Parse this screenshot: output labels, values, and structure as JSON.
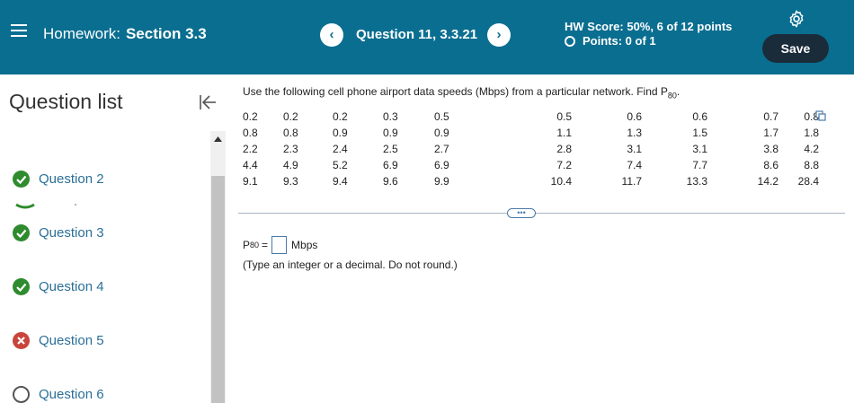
{
  "header": {
    "homework_label": "Homework:",
    "section": "Section 3.3",
    "question_title": "Question 11, 3.3.21",
    "prev_glyph": "‹",
    "next_glyph": "›",
    "hw_score": "HW Score: 50%, 6 of 12 points",
    "points": "Points: 0 of 1",
    "save_label": "Save"
  },
  "sidebar": {
    "title": "Question list",
    "items": [
      {
        "label": "Question 2",
        "status": "correct"
      },
      {
        "label": "Question 3",
        "status": "correct"
      },
      {
        "label": "Question 4",
        "status": "correct"
      },
      {
        "label": "Question 5",
        "status": "incorrect"
      },
      {
        "label": "Question 6",
        "status": "unanswered"
      }
    ]
  },
  "main": {
    "prompt_text": "Use the following cell phone airport data speeds (Mbps) from a particular network. Find P",
    "prompt_sub": "80",
    "prompt_end": ".",
    "data_rows": [
      [
        "0.2",
        "0.2",
        "0.2",
        "0.3",
        "0.5",
        "0.5",
        "0.6",
        "0.6",
        "0.7",
        "0.8"
      ],
      [
        "0.8",
        "0.8",
        "0.9",
        "0.9",
        "0.9",
        "1.1",
        "1.3",
        "1.5",
        "1.7",
        "1.8"
      ],
      [
        "2.2",
        "2.3",
        "2.4",
        "2.5",
        "2.7",
        "2.8",
        "3.1",
        "3.1",
        "3.8",
        "4.2"
      ],
      [
        "4.4",
        "4.9",
        "5.2",
        "6.9",
        "6.9",
        "7.2",
        "7.4",
        "7.7",
        "8.6",
        "8.8"
      ],
      [
        "9.1",
        "9.3",
        "9.4",
        "9.6",
        "9.9",
        "10.4",
        "11.7",
        "13.3",
        "14.2",
        "28.4"
      ]
    ],
    "more_label": "•••",
    "answer_label": "P",
    "answer_sub": "80",
    "answer_eq": "=",
    "answer_value": "",
    "unit": "Mbps",
    "hint": "(Type an integer or a decimal. Do not round.)"
  },
  "colors": {
    "header_bg": "#0a6e90",
    "save_bg": "#1a2b3a",
    "correct": "#2e8b2e",
    "incorrect": "#c9453c",
    "link": "#2a6f97"
  }
}
